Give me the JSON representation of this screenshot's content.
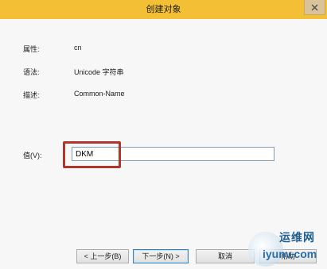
{
  "window": {
    "title": "创建对象"
  },
  "fields": {
    "attribute_label": "属性:",
    "attribute_value": "cn",
    "syntax_label": "语法:",
    "syntax_value": "Unicode 字符串",
    "description_label": "描述:",
    "description_value": "Common-Name",
    "value_label": "值(V):",
    "value_input": "DKM"
  },
  "buttons": {
    "back": "< 上一步(B)",
    "next": "下一步(N) >",
    "cancel": "取消",
    "help": "帮助"
  },
  "watermark": {
    "top_text": "运维网",
    "bottom_text": "iyunv.com"
  },
  "colors": {
    "titlebar": "#f3bf34",
    "highlight_border": "#b2352b"
  },
  "icons": {
    "close": "close-icon",
    "watermark_logo": "logo-circle"
  }
}
